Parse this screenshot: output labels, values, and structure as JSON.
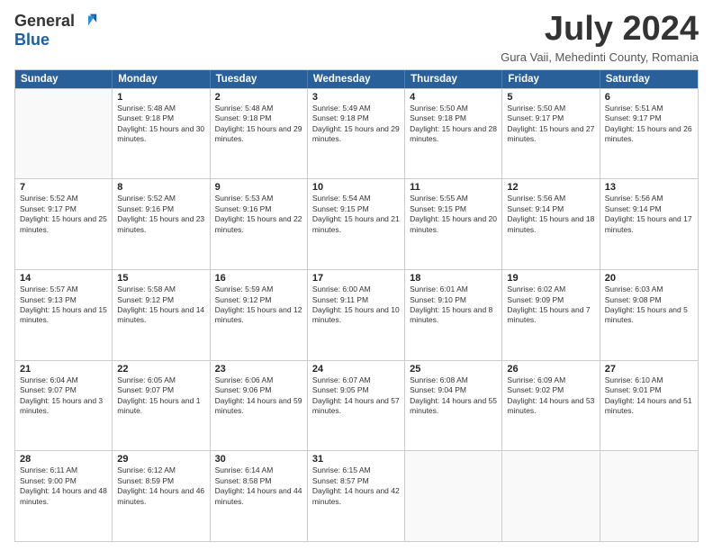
{
  "logo": {
    "general": "General",
    "blue": "Blue"
  },
  "title": "July 2024",
  "location": "Gura Vaii, Mehedinti County, Romania",
  "days": [
    "Sunday",
    "Monday",
    "Tuesday",
    "Wednesday",
    "Thursday",
    "Friday",
    "Saturday"
  ],
  "weeks": [
    [
      {
        "day": "",
        "empty": true
      },
      {
        "day": "1",
        "sunrise": "5:48 AM",
        "sunset": "9:18 PM",
        "daylight": "15 hours and 30 minutes."
      },
      {
        "day": "2",
        "sunrise": "5:48 AM",
        "sunset": "9:18 PM",
        "daylight": "15 hours and 29 minutes."
      },
      {
        "day": "3",
        "sunrise": "5:49 AM",
        "sunset": "9:18 PM",
        "daylight": "15 hours and 29 minutes."
      },
      {
        "day": "4",
        "sunrise": "5:50 AM",
        "sunset": "9:18 PM",
        "daylight": "15 hours and 28 minutes."
      },
      {
        "day": "5",
        "sunrise": "5:50 AM",
        "sunset": "9:17 PM",
        "daylight": "15 hours and 27 minutes."
      },
      {
        "day": "6",
        "sunrise": "5:51 AM",
        "sunset": "9:17 PM",
        "daylight": "15 hours and 26 minutes."
      }
    ],
    [
      {
        "day": "7",
        "sunrise": "5:52 AM",
        "sunset": "9:17 PM",
        "daylight": "15 hours and 25 minutes."
      },
      {
        "day": "8",
        "sunrise": "5:52 AM",
        "sunset": "9:16 PM",
        "daylight": "15 hours and 23 minutes."
      },
      {
        "day": "9",
        "sunrise": "5:53 AM",
        "sunset": "9:16 PM",
        "daylight": "15 hours and 22 minutes."
      },
      {
        "day": "10",
        "sunrise": "5:54 AM",
        "sunset": "9:15 PM",
        "daylight": "15 hours and 21 minutes."
      },
      {
        "day": "11",
        "sunrise": "5:55 AM",
        "sunset": "9:15 PM",
        "daylight": "15 hours and 20 minutes."
      },
      {
        "day": "12",
        "sunrise": "5:56 AM",
        "sunset": "9:14 PM",
        "daylight": "15 hours and 18 minutes."
      },
      {
        "day": "13",
        "sunrise": "5:56 AM",
        "sunset": "9:14 PM",
        "daylight": "15 hours and 17 minutes."
      }
    ],
    [
      {
        "day": "14",
        "sunrise": "5:57 AM",
        "sunset": "9:13 PM",
        "daylight": "15 hours and 15 minutes."
      },
      {
        "day": "15",
        "sunrise": "5:58 AM",
        "sunset": "9:12 PM",
        "daylight": "15 hours and 14 minutes."
      },
      {
        "day": "16",
        "sunrise": "5:59 AM",
        "sunset": "9:12 PM",
        "daylight": "15 hours and 12 minutes."
      },
      {
        "day": "17",
        "sunrise": "6:00 AM",
        "sunset": "9:11 PM",
        "daylight": "15 hours and 10 minutes."
      },
      {
        "day": "18",
        "sunrise": "6:01 AM",
        "sunset": "9:10 PM",
        "daylight": "15 hours and 8 minutes."
      },
      {
        "day": "19",
        "sunrise": "6:02 AM",
        "sunset": "9:09 PM",
        "daylight": "15 hours and 7 minutes."
      },
      {
        "day": "20",
        "sunrise": "6:03 AM",
        "sunset": "9:08 PM",
        "daylight": "15 hours and 5 minutes."
      }
    ],
    [
      {
        "day": "21",
        "sunrise": "6:04 AM",
        "sunset": "9:07 PM",
        "daylight": "15 hours and 3 minutes."
      },
      {
        "day": "22",
        "sunrise": "6:05 AM",
        "sunset": "9:07 PM",
        "daylight": "15 hours and 1 minute."
      },
      {
        "day": "23",
        "sunrise": "6:06 AM",
        "sunset": "9:06 PM",
        "daylight": "14 hours and 59 minutes."
      },
      {
        "day": "24",
        "sunrise": "6:07 AM",
        "sunset": "9:05 PM",
        "daylight": "14 hours and 57 minutes."
      },
      {
        "day": "25",
        "sunrise": "6:08 AM",
        "sunset": "9:04 PM",
        "daylight": "14 hours and 55 minutes."
      },
      {
        "day": "26",
        "sunrise": "6:09 AM",
        "sunset": "9:02 PM",
        "daylight": "14 hours and 53 minutes."
      },
      {
        "day": "27",
        "sunrise": "6:10 AM",
        "sunset": "9:01 PM",
        "daylight": "14 hours and 51 minutes."
      }
    ],
    [
      {
        "day": "28",
        "sunrise": "6:11 AM",
        "sunset": "9:00 PM",
        "daylight": "14 hours and 48 minutes."
      },
      {
        "day": "29",
        "sunrise": "6:12 AM",
        "sunset": "8:59 PM",
        "daylight": "14 hours and 46 minutes."
      },
      {
        "day": "30",
        "sunrise": "6:14 AM",
        "sunset": "8:58 PM",
        "daylight": "14 hours and 44 minutes."
      },
      {
        "day": "31",
        "sunrise": "6:15 AM",
        "sunset": "8:57 PM",
        "daylight": "14 hours and 42 minutes."
      },
      {
        "day": "",
        "empty": true
      },
      {
        "day": "",
        "empty": true
      },
      {
        "day": "",
        "empty": true
      }
    ]
  ]
}
